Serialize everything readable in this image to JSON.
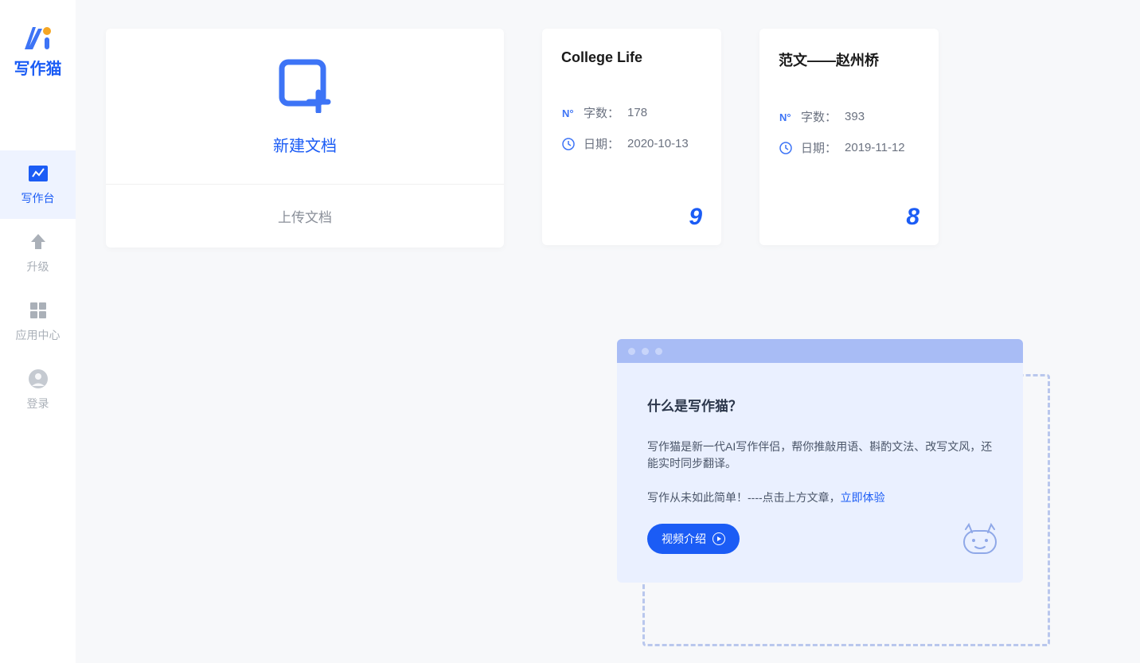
{
  "logo": {
    "text": "写作猫"
  },
  "sidebar": {
    "items": [
      {
        "label": "写作台"
      },
      {
        "label": "升级"
      },
      {
        "label": "应用中心"
      },
      {
        "label": "登录"
      }
    ]
  },
  "newDoc": {
    "label": "新建文档",
    "uploadLabel": "上传文档"
  },
  "docs": [
    {
      "title": "College Life",
      "wordLabel": "字数：",
      "wordCount": "178",
      "dateLabel": "日期：",
      "date": "2020-10-13",
      "score": "9"
    },
    {
      "title": "范文——赵州桥",
      "wordLabel": "字数：",
      "wordCount": "393",
      "dateLabel": "日期：",
      "date": "2019-11-12",
      "score": "8"
    }
  ],
  "promo": {
    "heading": "什么是写作猫？",
    "text1": "写作猫是新一代AI写作伴侣，帮你推敲用语、斟酌文法、改写文风，还能实时同步翻译。",
    "text2": "写作从未如此简单！----点击上方文章，",
    "linkText": "立即体验",
    "videoButton": "视频介绍"
  }
}
